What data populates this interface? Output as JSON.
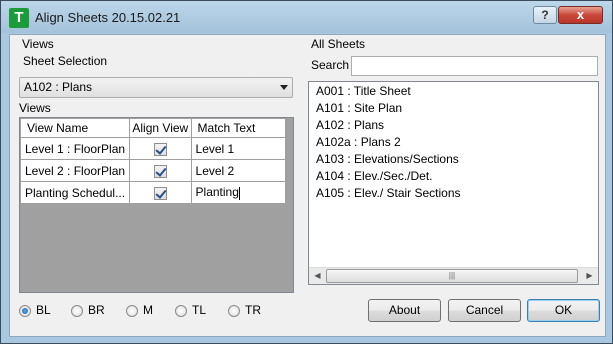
{
  "window": {
    "app_icon_glyph": "T",
    "title": "Align Sheets 20.15.02.21",
    "help_glyph": "?",
    "close_glyph": "x"
  },
  "views_group": {
    "label": "Views",
    "sheet_selection_label": "Sheet Selection",
    "sheet_selection_value": "A102 : Plans",
    "views_label": "Views",
    "grid": {
      "columns": [
        "View Name",
        "Align View",
        "Match Text"
      ],
      "rows": [
        {
          "view_name": "Level 1 : FloorPlan",
          "align": true,
          "match_text": "Level 1"
        },
        {
          "view_name": "Level 2 : FloorPlan",
          "align": true,
          "match_text": "Level 2"
        },
        {
          "view_name": "Planting Schedul...",
          "align": true,
          "match_text": "Planting"
        }
      ]
    }
  },
  "all_sheets_group": {
    "label": "All Sheets",
    "search_label": "Search",
    "search_value": "",
    "sheets": [
      "A001 : Title Sheet",
      "A101 : Site Plan",
      "A102 : Plans",
      "A102a : Plans 2",
      "A103 : Elevations/Sections",
      "A104 : Elev./Sec./Det.",
      "A105 : Elev./ Stair Sections"
    ]
  },
  "alignment_options": [
    {
      "label": "BL",
      "selected": true
    },
    {
      "label": "BR",
      "selected": false
    },
    {
      "label": "M",
      "selected": false
    },
    {
      "label": "TL",
      "selected": false
    },
    {
      "label": "TR",
      "selected": false
    }
  ],
  "buttons": {
    "about": "About",
    "cancel": "Cancel",
    "ok": "OK"
  },
  "icons": {
    "app": "align-sheets-app-icon",
    "help": "help-icon",
    "close": "close-icon",
    "combo": "chevron-down-icon",
    "scroll_left": "arrow-left-icon",
    "scroll_right": "arrow-right-icon"
  }
}
